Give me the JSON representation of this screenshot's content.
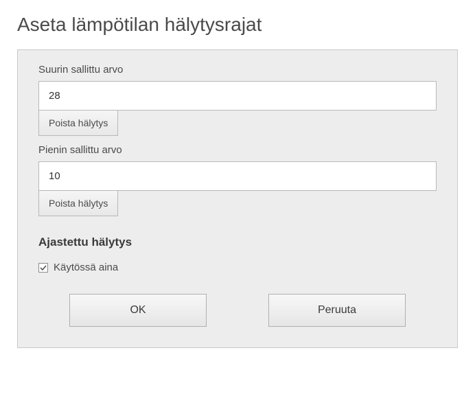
{
  "title": "Aseta lämpötilan hälytysrajat",
  "max": {
    "label": "Suurin sallittu arvo",
    "value": "28",
    "remove_label": "Poista hälytys"
  },
  "min": {
    "label": "Pienin sallittu arvo",
    "value": "10",
    "remove_label": "Poista hälytys"
  },
  "scheduled": {
    "heading": "Ajastettu hälytys",
    "always_enabled_label": "Käytössä aina",
    "always_enabled_checked": true
  },
  "buttons": {
    "ok": "OK",
    "cancel": "Peruuta"
  }
}
